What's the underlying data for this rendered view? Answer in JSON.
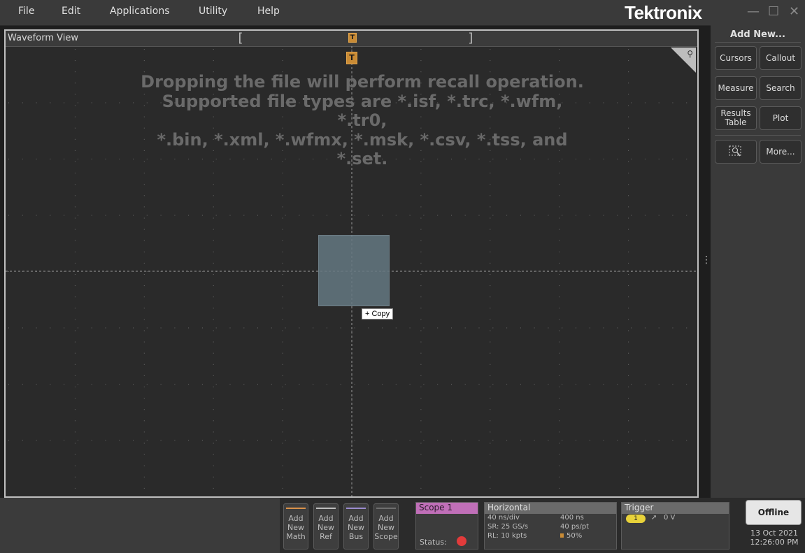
{
  "menubar": {
    "items": [
      "File",
      "Edit",
      "Applications",
      "Utility",
      "Help"
    ],
    "brand": "Tektronix",
    "window_controls": [
      "—",
      "☐",
      "✕"
    ]
  },
  "waveform_view": {
    "title": "Waveform View",
    "drop_message_lines": [
      "Dropping the file will perform recall operation.",
      "Supported file types are *.isf, *.trc, *.wfm, *.tr0,",
      "*.bin, *.xml, *.wfmx, *.msk, *.csv, *.tss, and *.set."
    ],
    "drag_tooltip": "+ Copy",
    "trigger_marker_label": "T"
  },
  "right_panel": {
    "title": "Add New...",
    "buttons": {
      "cursors": "Cursors",
      "callout": "Callout",
      "measure": "Measure",
      "search": "Search",
      "results_table_line1": "Results",
      "results_table_line2": "Table",
      "plot": "Plot",
      "more": "More..."
    }
  },
  "bottom_bar": {
    "add_buttons": [
      {
        "line1": "Add",
        "line2": "New",
        "line3": "Math",
        "color": "#d9924a"
      },
      {
        "line1": "Add",
        "line2": "New",
        "line3": "Ref",
        "color": "#bdbdbd"
      },
      {
        "line1": "Add",
        "line2": "New",
        "line3": "Bus",
        "color": "#9b8ccf"
      },
      {
        "line1": "Add",
        "line2": "New",
        "line3": "Scope",
        "color": "#6e6e6e"
      }
    ],
    "scope": {
      "title": "Scope 1",
      "status_label": "Status:",
      "status_color": "#e23b3b",
      "accent": "#c06fb8"
    },
    "horizontal": {
      "title": "Horizontal",
      "col1": [
        "40 ns/div",
        "SR: 25 GS/s",
        "RL: 10 kpts"
      ],
      "col2": [
        "400 ns",
        "40 ps/pt",
        "50%"
      ]
    },
    "trigger": {
      "title": "Trigger",
      "channel": "1",
      "level": "0 V"
    },
    "offline_label": "Offline",
    "date": "13 Oct 2021",
    "time": "12:26:00 PM"
  }
}
